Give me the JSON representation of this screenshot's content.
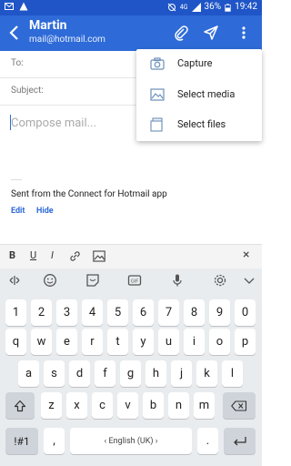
{
  "status": {
    "time": "19:42",
    "battery": "36%",
    "network": "4G"
  },
  "header": {
    "contact_name": "Martin",
    "contact_email": "mail@hotmail.com"
  },
  "compose": {
    "to_label": "To:",
    "subject_label": "Subject:",
    "body_placeholder": "Compose mail...",
    "signature": "Sent from the Connect for Hotmail app",
    "edit_label": "Edit",
    "hide_label": "Hide"
  },
  "menu": {
    "items": [
      "Capture",
      "Select media",
      "Select files"
    ]
  },
  "format_toolbar": {
    "bold": "B",
    "underline": "U",
    "italic": "I",
    "close": "×"
  },
  "keyboard": {
    "numbers": [
      "1",
      "2",
      "3",
      "4",
      "5",
      "6",
      "7",
      "8",
      "9",
      "0"
    ],
    "row1": [
      "q",
      "w",
      "e",
      "r",
      "t",
      "y",
      "u",
      "i",
      "o",
      "p"
    ],
    "row2": [
      "a",
      "s",
      "d",
      "f",
      "g",
      "h",
      "j",
      "k",
      "l"
    ],
    "row3": [
      "z",
      "x",
      "c",
      "v",
      "b",
      "n",
      "m"
    ],
    "symbols": "!#1",
    "comma": ",",
    "period": ".",
    "space_label": "English (UK)"
  }
}
